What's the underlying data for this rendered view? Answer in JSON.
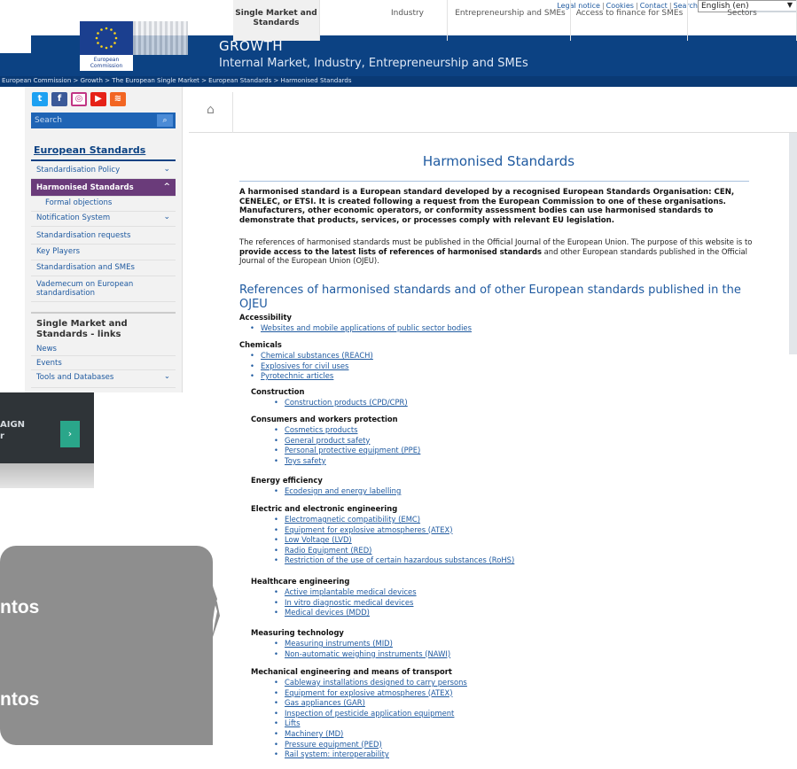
{
  "topbar": {
    "links": [
      "Legal notice",
      "Cookies",
      "Contact",
      "Search"
    ],
    "language": "English (en)"
  },
  "logo": {
    "line1": "European",
    "line2": "Commission"
  },
  "header": {
    "title": "GROWTH",
    "subtitle": "Internal Market, Industry, Entrepreneurship and SMEs"
  },
  "breadcrumb": "European Commission > Growth > The European Single Market > European Standards > Harmonised Standards",
  "social": [
    "twitter-icon",
    "facebook-icon",
    "instagram-icon",
    "youtube-icon",
    "rss-icon"
  ],
  "search": {
    "placeholder": "Search"
  },
  "nav": {
    "title": "European Standards",
    "items": [
      {
        "label": "Standardisation Policy"
      },
      {
        "label": "Harmonised Standards"
      },
      {
        "label": "Formal objections"
      },
      {
        "label": "Notification System"
      },
      {
        "label": "Standardisation requests"
      },
      {
        "label": "Key Players"
      },
      {
        "label": "Standardisation and SMEs"
      },
      {
        "label": "Vademecum on European standardisation"
      }
    ]
  },
  "links_box": {
    "title": "Single Market and Standards - links",
    "items": [
      "News",
      "Events",
      "Tools and Databases"
    ]
  },
  "tabs": [
    {
      "label": "Single Market and Standards"
    },
    {
      "label": "Industry"
    },
    {
      "label": "Entrepreneurship and SMEs"
    },
    {
      "label": "Access to finance for SMEs"
    },
    {
      "label": "Sectors"
    }
  ],
  "main": {
    "title": "Harmonised Standards",
    "intro1": "A harmonised standard is a European standard developed by a recognised European Standards Organisation: CEN, CENELEC, or ETSI. It is created following a request from the European Commission to one of these organisations. Manufacturers, other economic operators, or conformity assessment bodies can use harmonised standards to demonstrate that products, services, or processes comply with relevant EU legislation.",
    "intro2_a": "The references of harmonised standards must be published in the Official Journal of the European Union. The purpose of this website is to ",
    "intro2_b": "provide access to the latest lists of references of harmonised standards",
    "intro2_c": " and other European standards published in the Official Journal of the European Union (OJEU).",
    "refs_heading": "References of harmonised standards and of other European standards published in the OJEU",
    "categories": [
      {
        "name": "Accessibility",
        "items": [
          "Websites and mobile applications of public sector bodies"
        ]
      },
      {
        "name": "Chemicals",
        "items": [
          "Chemical substances (REACH)",
          "Explosives for civil uses",
          "Pyrotechnic articles"
        ]
      },
      {
        "name": "Construction",
        "items": [
          "Construction products (CPD/CPR)"
        ]
      },
      {
        "name": "Consumers and workers protection",
        "items": [
          "Cosmetics products",
          "General product safety",
          "Personal protective equipment (PPE)",
          "Toys safety"
        ]
      },
      {
        "name": "Energy efficiency",
        "items": [
          "Ecodesign and energy labelling"
        ]
      },
      {
        "name": "Electric and electronic engineering",
        "items": [
          "Electromagnetic compatibility (EMC)",
          "Equipment for explosive atmospheres (ATEX)",
          "Low Voltage (LVD)",
          "Radio Equipment (RED)",
          "Restriction of the use of certain hazardous substances (RoHS)"
        ]
      },
      {
        "name": "Healthcare engineering",
        "items": [
          "Active implantable medical devices",
          "In vitro diagnostic medical devices",
          "Medical devices (MDD)"
        ]
      },
      {
        "name": "Measuring technology",
        "items": [
          "Measuring instruments (MID)",
          "Non-automatic weighing instruments (NAWI)"
        ]
      },
      {
        "name": "Mechanical engineering and means of transport",
        "items": [
          "Cableway installations designed to carry persons",
          "Equipment for explosive atmospheres (ATEX)",
          "Gas appliances (GAR)",
          "Inspection of pesticide application equipment",
          "Lifts",
          "Machinery (MD)",
          "Pressure equipment (PED)",
          "Rail system: interoperability"
        ]
      }
    ]
  },
  "promo": {
    "line1": "AIGN",
    "line2": "r"
  },
  "callout": {
    "line1": "ntos",
    "line2": "ntos"
  },
  "colors": {
    "eu_blue": "#0c4283",
    "link": "#1f5aa0",
    "active_nav": "#6a3b7a",
    "callout": "#8e8e8e"
  }
}
